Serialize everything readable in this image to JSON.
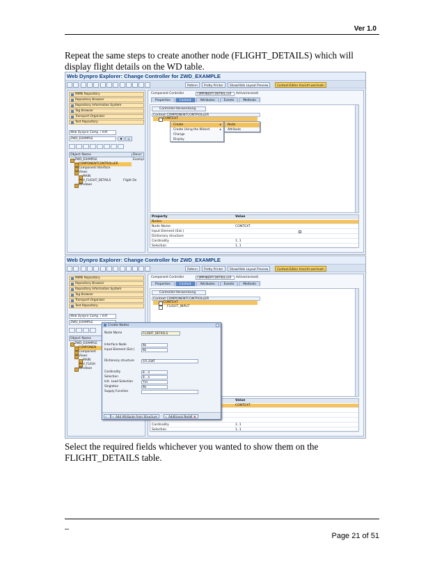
{
  "header": {
    "version": "Ver 1.0"
  },
  "text": {
    "para1": "Repeat the same steps to create another node (FLIGHT_DETAILS) which will display flight details on the WD table.",
    "para2": "Select the required fields whichever you wanted to show them on the FLIGHT_DETAILS table."
  },
  "footer": {
    "dash": "–",
    "page": "Page 21 of 51"
  },
  "screens": {
    "title": "Web Dynpro Explorer: Change Controller for ZWD_EXAMPLE",
    "toolbar": {
      "pattern": "Pattern",
      "pretty_printer": "Pretty Printer",
      "layout_preview": "Show/Hide Layout Preview",
      "context_editor": "Context-Editor Ansicht wechseln"
    },
    "nav": [
      "MIME Repository",
      "Repository Browser",
      "Repository Information System",
      "Tag Browser",
      "Transport Organizer",
      "Test Repository"
    ],
    "combo_value": "Web Dynpro Comp. / Intf.",
    "combo_name": "ZWD_EXAMPLE",
    "obj_table": {
      "col_name": "Object Name",
      "col_desc": "Descr"
    },
    "tree1": [
      "ZWD_EXAMPLE",
      "COMPONENTCONTROLLER",
      "Component Interface",
      "Views",
      "MAIN",
      "V_FLIGHT_DETAILS",
      "Windows"
    ],
    "tree1_desc": [
      "Exampl",
      "Flight De"
    ],
    "tree2": [
      "ZWD_EXAMPLE",
      "COMPONEN",
      "Component",
      "Views",
      "MAIN",
      "V_FLIGH",
      "Windows"
    ],
    "component_label": "Component Controller",
    "component_value": "COMPONENTCONTROLLER",
    "component_status": "Active(revised)",
    "tabs": [
      "Properties",
      "Context",
      "Attributes",
      "Events",
      "Methods"
    ],
    "ctx_button": "Controller-Verwendung",
    "ctx_header": "Context COMPONENTCONTROLLER",
    "ctx_node_context": "CONTEXT",
    "ctx_node_flight_input": "FLIGHT_INPUT",
    "menu1": [
      "Create",
      "Create Using the Wizard",
      "Change",
      "Display"
    ],
    "menu2": [
      "Node",
      "Attribute"
    ],
    "props": {
      "hdr_property": "Property",
      "hdr_value": "Value",
      "rows1": [
        [
          "Nodes",
          ""
        ],
        [
          "Node Name",
          "CONTEXT"
        ],
        [
          "Input Element (Ext.)",
          ""
        ],
        [
          "Dictionary structure",
          ""
        ],
        [
          "Cardinality",
          "1..1"
        ],
        [
          "Selection",
          "1..1"
        ]
      ],
      "rows2": [
        [
          "",
          "CONTEXT"
        ],
        [
          "",
          ""
        ],
        [
          "",
          ""
        ],
        [
          "",
          ""
        ],
        [
          "Cardinality",
          "1..1"
        ],
        [
          "Selection",
          "1..1"
        ]
      ]
    },
    "dialog": {
      "title": "Create Nodes",
      "fields": [
        [
          "Node Name",
          "FLIGHT_DETAILS"
        ],
        [
          "Interface Node",
          "No"
        ],
        [
          "Input Element (Ext.)",
          "No"
        ],
        [
          "Dictionary structure",
          "SFLIGHT"
        ],
        [
          "Cardinality",
          "0..n"
        ],
        [
          "Selection",
          "0..n"
        ],
        [
          "Init. Lead Selection",
          "Yes"
        ],
        [
          "Singleton",
          "No"
        ],
        [
          "Supply Function",
          ""
        ]
      ],
      "btn_add_attr": "Add Attribute from Structure",
      "btn_add_node": "Additional Node"
    }
  }
}
